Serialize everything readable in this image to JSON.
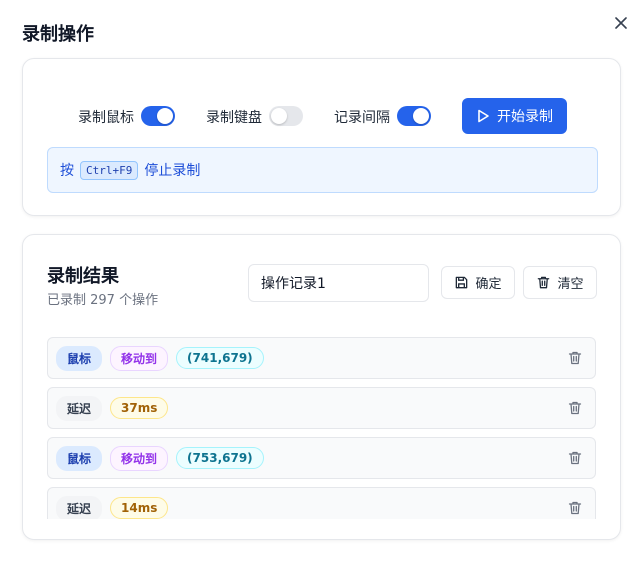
{
  "dialog": {
    "title": "录制操作"
  },
  "settings": {
    "record_mouse": {
      "label": "录制鼠标",
      "enabled": true
    },
    "record_keyboard": {
      "label": "录制键盘",
      "enabled": false
    },
    "record_interval": {
      "label": "记录间隔",
      "enabled": true
    },
    "start_button": "开始录制",
    "hint": {
      "prefix": "按",
      "shortcut": "Ctrl+F9",
      "suffix": "停止录制"
    }
  },
  "results": {
    "title": "录制结果",
    "count_text": "已录制 297 个操作",
    "name_value": "操作记录1",
    "confirm_label": "确定",
    "clear_label": "清空",
    "rows": [
      {
        "type": "鼠标",
        "action": "移动到",
        "value": "(741,679)"
      },
      {
        "type": "延迟",
        "value": "37ms"
      },
      {
        "type": "鼠标",
        "action": "移动到",
        "value": "(753,679)"
      },
      {
        "type": "延迟",
        "value": "14ms"
      }
    ]
  },
  "colors": {
    "accent": "#2563eb",
    "hint_bg": "#eff6ff",
    "hint_text": "#1d4ed8"
  }
}
